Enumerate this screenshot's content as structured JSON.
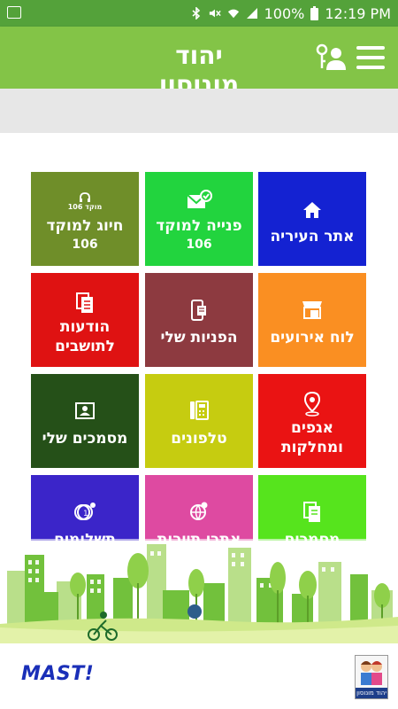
{
  "status_bar": {
    "battery": "100%",
    "time": "12:19 PM"
  },
  "app_bar": {
    "title": "יהוד מונוסון"
  },
  "tiles": [
    {
      "label": "אתר העיריה",
      "sub": "",
      "icon": "home-icon",
      "color": "#1422d2"
    },
    {
      "label": "פנייה למוקד",
      "sub": "106",
      "icon": "mail-check-icon",
      "color": "#22d43e"
    },
    {
      "label": "חיוג למוקד",
      "sub": "106",
      "icon": "headset-icon",
      "badge": "מוקד 106",
      "color": "#6f8e29"
    },
    {
      "label": "לוח אירועים",
      "sub": "",
      "icon": "store-calendar-icon",
      "color": "#fa8f22"
    },
    {
      "label": "הפניות שלי",
      "sub": "",
      "icon": "phone-document-icon",
      "color": "#8d3a40"
    },
    {
      "label": "הודעות לתושבים",
      "sub": "",
      "icon": "documents-icon",
      "color": "#df1212"
    },
    {
      "label": "אגפים ומחלקות",
      "sub": "",
      "icon": "map-pin-icon",
      "color": "#ea1313"
    },
    {
      "label": "טלפונים",
      "sub": "",
      "icon": "phone-book-icon",
      "color": "#c6cc10"
    },
    {
      "label": "מסמכים שלי",
      "sub": "",
      "icon": "id-card-icon",
      "color": "#255018"
    },
    {
      "label": "מסמכים מקוונים",
      "sub": "",
      "icon": "documents-icon",
      "color": "#56e41d"
    },
    {
      "label": "אתרי תיירות",
      "sub": "",
      "icon": "globe-icon",
      "color": "#de4aa1"
    },
    {
      "label": "תשלומים",
      "sub": "",
      "icon": "coins-icon",
      "color": "#3b25c9"
    }
  ],
  "footer": {
    "brand": "MAST!",
    "logo_caption": "יהוד מונוסון"
  }
}
